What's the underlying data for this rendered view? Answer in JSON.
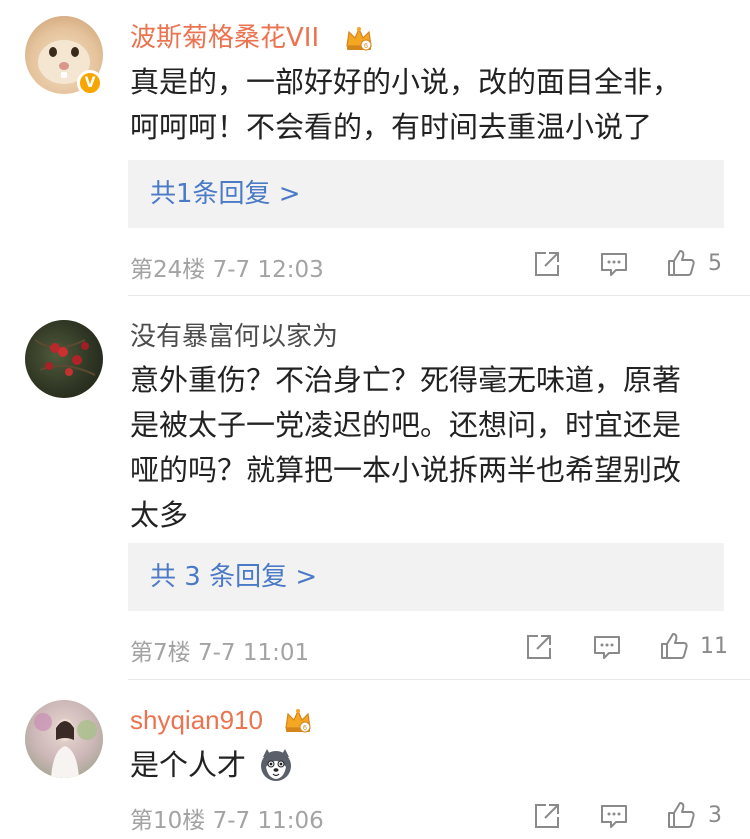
{
  "comments": [
    {
      "username": "波斯菊格桑花VII",
      "content_lines": [
        "真是的，一部好好的小说，改的面目全非，",
        "呵呵呵！不会看的，有时间去重温小说了"
      ],
      "replies_label": "共1条回复 >",
      "floor_time": "第24楼  7-7 12:03",
      "likes": "5"
    },
    {
      "username": "没有暴富何以家为",
      "content_lines": [
        "意外重伤？不治身亡？死得毫无味道，原著",
        "是被太子一党凌迟的吧。还想问，时宜还是",
        "哑的吗？就算把一本小说拆两半也希望别改",
        "太多"
      ],
      "replies_label": "共 3 条回复 >",
      "floor_time": "第7楼  7-7 11:01",
      "likes": "11"
    },
    {
      "username": "shyqian910",
      "content_lines": [
        "是个人才"
      ],
      "floor_time": "第10楼  7-7 11:06",
      "likes": "3"
    }
  ],
  "colors": {
    "vip_name": "#eb7350",
    "link": "#4b7ac7",
    "meta": "#a3a3a3",
    "reply_bg": "#f2f2f2",
    "crown": "#f5a623"
  },
  "icons": [
    "verified-badge-icon",
    "vip-crown-icon",
    "share-icon",
    "comment-icon",
    "like-icon",
    "husky-emoji-icon"
  ]
}
